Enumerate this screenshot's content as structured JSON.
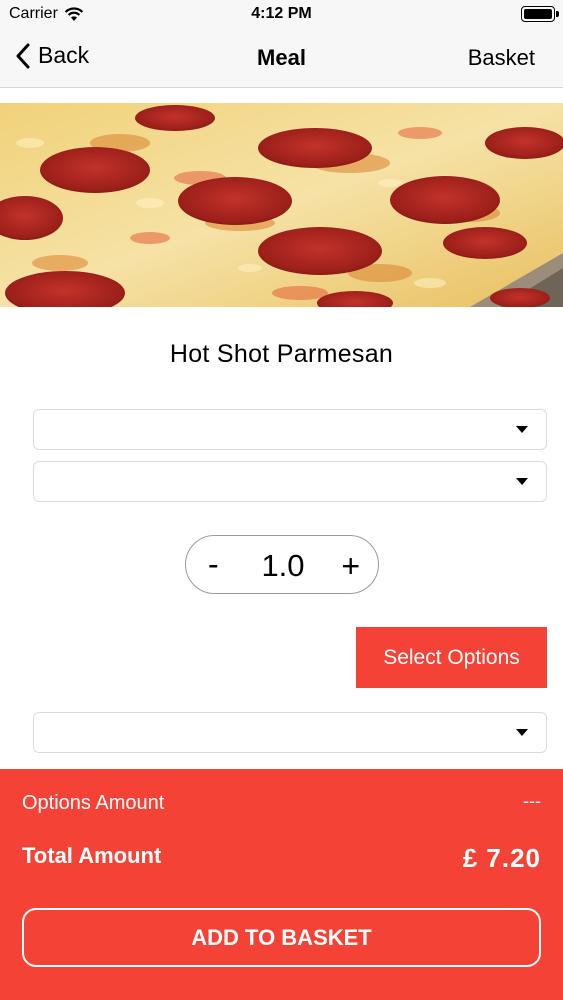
{
  "status_bar": {
    "carrier": "Carrier",
    "time": "4:12 PM"
  },
  "nav": {
    "back_label": "Back",
    "title": "Meal",
    "basket_label": "Basket"
  },
  "product": {
    "name": "Hot Shot Parmesan"
  },
  "quantity": {
    "value": "1.0",
    "minus_label": "-",
    "plus_label": "+"
  },
  "select_options_label": "Select Options",
  "footer": {
    "options_amount_label": "Options Amount",
    "options_amount_value": "---",
    "total_label": "Total Amount",
    "total_value": "£ 7.20",
    "add_to_basket_label": "ADD TO BASKET"
  },
  "colors": {
    "accent": "#f44336",
    "nav_bg": "#f7f7f7"
  }
}
